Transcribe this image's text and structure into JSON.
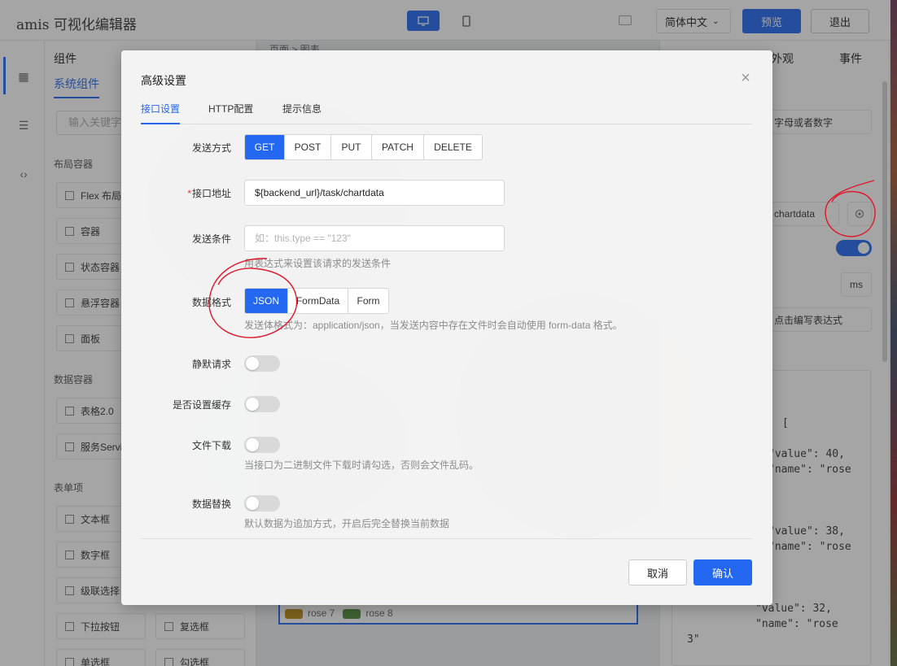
{
  "app": {
    "title": "amis 可视化编辑器",
    "language": "简体中文",
    "preview_label": "预览",
    "exit_label": "退出"
  },
  "component_panel": {
    "header": "组件",
    "tab": "系统组件",
    "search_placeholder": "输入关键字",
    "groups": [
      {
        "title": "布局容器",
        "items": [
          "Flex 布局",
          "容器",
          "状态容器",
          "悬浮容器",
          "面板"
        ]
      },
      {
        "title": "数据容器",
        "items": [
          "表格2.0",
          "服务Service"
        ]
      },
      {
        "title": "表单项",
        "items": [
          "文本框",
          "数字框",
          "级联选择",
          "下拉按钮",
          "复选框",
          "单选框",
          "勾选框"
        ]
      }
    ]
  },
  "canvas": {
    "breadcrumb": "页面 > 图表",
    "legend": [
      {
        "name": "rose 7",
        "color": "#b98a16"
      },
      {
        "name": "rose 8",
        "color": "#4e8a3c"
      }
    ]
  },
  "prop_panel": {
    "tab_view": "外观",
    "tab_event": "事件",
    "field_hint": "字母或者数字",
    "api_value": "chartdata",
    "unit": "ms",
    "expr_placeholder": "点击编写表达式",
    "code_lines": [
      "[",
      "\"value\": 40,",
      "\"name\": \"rose",
      "\"value\": 38,",
      "\"name\": \"rose",
      "\"value\": 32,",
      "\"name\": \"rose",
      "3\""
    ]
  },
  "modal": {
    "title": "高级设置",
    "tabs": [
      "接口设置",
      "HTTP配置",
      "提示信息"
    ],
    "active_tab": "接口设置",
    "method": {
      "label": "发送方式",
      "options": [
        "GET",
        "POST",
        "PUT",
        "PATCH",
        "DELETE"
      ],
      "selected": "GET"
    },
    "url": {
      "label": "接口地址",
      "required_mark": "*",
      "value": "${backend_url}/task/chartdata"
    },
    "send_on": {
      "label": "发送条件",
      "placeholder": "如：this.type == \"123\"",
      "hint": "用表达式来设置该请求的发送条件"
    },
    "data_type": {
      "label": "数据格式",
      "options": [
        "JSON",
        "FormData",
        "Form"
      ],
      "selected": "JSON",
      "hint": "发送体格式为：application/json，当发送内容中存在文件时会自动使用 form-data 格式。"
    },
    "silent": {
      "label": "静默请求",
      "on": false
    },
    "cache": {
      "label": "是否设置缓存",
      "on": false
    },
    "download": {
      "label": "文件下载",
      "on": false,
      "hint": "当接口为二进制文件下载时请勾选，否则会文件乱码。"
    },
    "replace": {
      "label": "数据替换",
      "on": false,
      "hint": "默认数据为追加方式，开启后完全替换当前数据"
    },
    "cancel_label": "取消",
    "confirm_label": "确认"
  },
  "colors": {
    "accent": "#2468f2",
    "annotation": "#e0162b"
  }
}
